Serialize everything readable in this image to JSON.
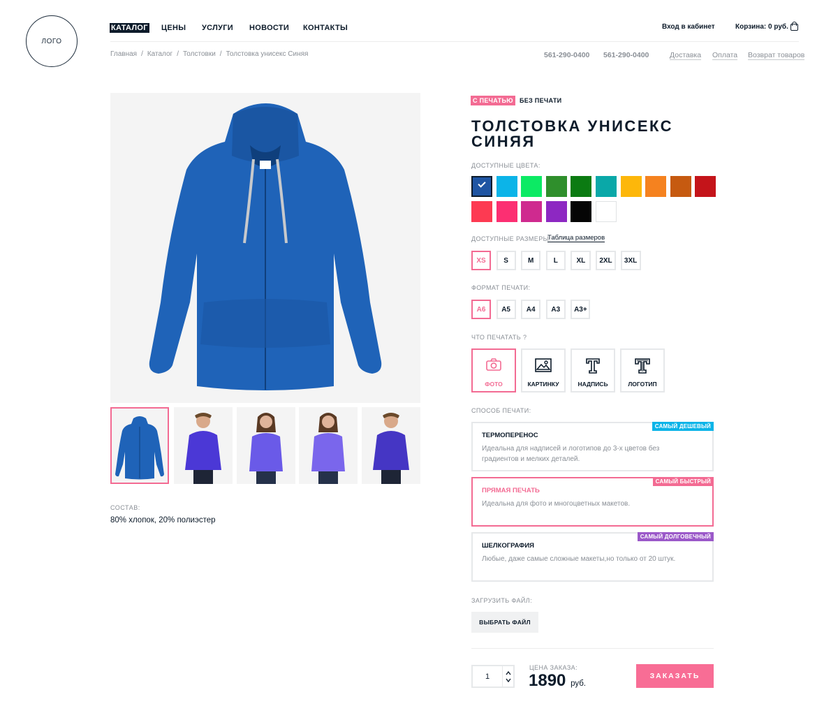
{
  "header": {
    "logo": "ЛОГО",
    "nav": [
      "КАТАЛОГ",
      "ЦЕНЫ",
      "УСЛУГИ",
      "НОВОСТИ",
      "КОНТАКТЫ"
    ],
    "login": "Вход в кабинет",
    "cart_label": "Корзина:",
    "cart_value": "0 руб."
  },
  "breadcrumbs": {
    "items": [
      "Главная",
      "Каталог",
      "Толстовки",
      "Толстовка унисекс Синяя"
    ],
    "separator": "/"
  },
  "contacts": {
    "phones": [
      "561-290-0400",
      "561-290-0400"
    ],
    "links": [
      "Доставка",
      "Оплата",
      "Возврат товаров"
    ]
  },
  "gallery": {
    "composition_label": "СОСТАВ:",
    "composition_value": "80% хлопок, 20% полиэстер"
  },
  "product": {
    "tabs": [
      "С ПЕЧАТЬЮ",
      "БЕЗ ПЕЧАТИ"
    ],
    "title": "ТОЛСТОВКА УНИСЕКС СИНЯЯ",
    "colors_label": "ДОСТУПНЫЕ  ЦВЕТА:",
    "colors": [
      "#1f55a3",
      "#0cb4e8",
      "#0cea64",
      "#2f8f2c",
      "#0b7b12",
      "#0aa8a8",
      "#fdb70a",
      "#f5821f",
      "#c65a10",
      "#c4141a",
      "#fd3a52",
      "#fc2f72",
      "#cf2a8f",
      "#8d28c2",
      "#050505",
      "#ffffff"
    ],
    "sizes_label": "ДОСТУПНЫЕ РАЗМЕРЫ:",
    "size_table_link": "Таблица размеров",
    "sizes": [
      "XS",
      "S",
      "M",
      "L",
      "XL",
      "2XL",
      "3XL"
    ],
    "print_format_label": "ФОРМАТ ПЕЧАТИ:",
    "formats": [
      "А6",
      "А5",
      "А4",
      "А3",
      "А3+"
    ],
    "print_what_label": "ЧТО ПЕЧАТАТЬ ?",
    "print_what": [
      {
        "label": "ФОТО",
        "icon": "camera-icon"
      },
      {
        "label": "КАРТИНКУ",
        "icon": "image-icon"
      },
      {
        "label": "НАДПИСЬ",
        "icon": "text-icon"
      },
      {
        "label": "ЛОГОТИП",
        "icon": "logo-icon"
      }
    ],
    "print_method_label": "СПОСОБ ПЕЧАТИ:",
    "methods": [
      {
        "title": "ТЕРМОПЕРЕНОС",
        "desc": "Идеальна для надписей и логотипов до 3-х цветов без градиентов и мелких деталей.",
        "badge": "САМЫЙ ДЕШЕВЫЙ",
        "badge_color": "#0cb4e8"
      },
      {
        "title": "ПРЯМАЯ ПЕЧАТЬ",
        "desc": "Идеальна для фото и многоцветных макетов.",
        "badge": "САМЫЙ БЫСТРЫЙ",
        "badge_color": "#f36b93"
      },
      {
        "title": "ШЕЛКОГРАФИЯ",
        "desc": "Любые, даже самые сложные макеты,но только от 20 штук.",
        "badge": "САМЫЙ  ДОЛГОВЕЧНЫЙ",
        "badge_color": "#9b59c9"
      }
    ],
    "upload_label": "ЗАГРУЗИТЬ ФАЙЛ:",
    "upload_button": "ВЫБРАТЬ ФАЙЛ",
    "quantity": "1",
    "price_label": "ЦЕНА ЗАКАЗА:",
    "price": "1890",
    "currency": "руб.",
    "order_button": "ЗАКАЗАТЬ"
  }
}
